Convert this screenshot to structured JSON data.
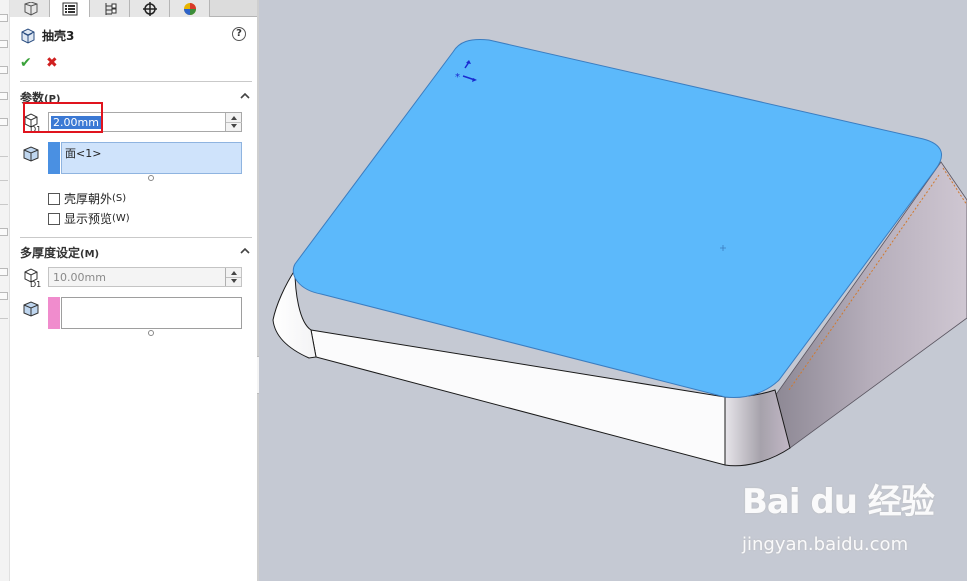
{
  "tabs": [
    {
      "name": "feature-manager",
      "icon": "feature-tree-icon"
    },
    {
      "name": "property-manager",
      "icon": "property-list-icon"
    },
    {
      "name": "configuration-manager",
      "icon": "configuration-icon"
    },
    {
      "name": "dimxpert-manager",
      "icon": "crosshair-icon"
    },
    {
      "name": "display-manager",
      "icon": "appearance-icon"
    }
  ],
  "pm": {
    "title": "抽壳3",
    "help": "?",
    "ok": "✔",
    "cancel": "✖"
  },
  "parameters": {
    "title": "参数",
    "hotkey": "(P)",
    "thickness": "2.00mm",
    "faces_item": "面<1>",
    "shell_outward": "壳厚朝外",
    "shell_outward_hotkey": "(S)",
    "show_preview": "显示预览",
    "show_preview_hotkey": "(W)",
    "face_swatch_color": "#4a90e2"
  },
  "multi_thickness": {
    "title": "多厚度设定",
    "hotkey": "(M)",
    "thickness": "10.00mm",
    "swatch_color": "#f08ccd"
  },
  "viewport": {
    "background": "#c5c9d3",
    "selected_face_color": "#5cb9fb"
  },
  "watermark": {
    "logo": "Bai du 经验",
    "url": "jingyan.baidu.com"
  }
}
